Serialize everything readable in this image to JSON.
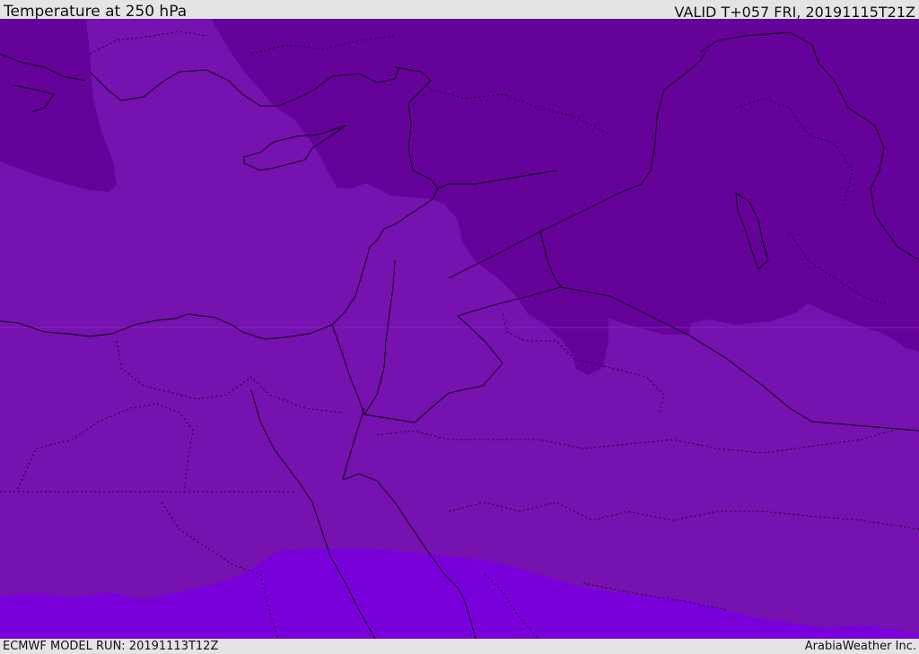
{
  "header": {
    "title": "Temperature at 250 hPa",
    "valid_time": "VALID T+057 FRI, 20191115T21Z"
  },
  "footer": {
    "model_run": "ECMWF MODEL RUN: 20191113T12Z",
    "credit": "ArabiaWeather Inc."
  },
  "map": {
    "variable": "temperature",
    "level": "250 hPa",
    "colors": {
      "dark_purple": "#65029a",
      "mid_purple": "#7612b0",
      "bright_violet": "#7a00db",
      "border_line": "#000000"
    }
  }
}
